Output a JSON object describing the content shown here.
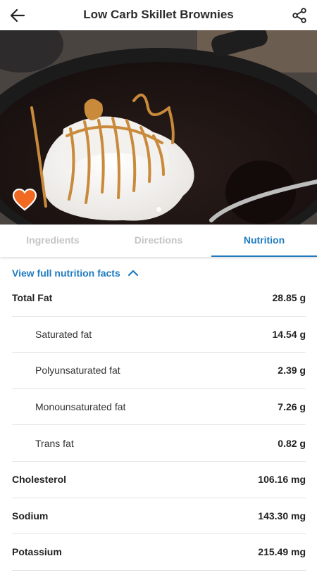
{
  "appbar": {
    "title": "Low Carb Skillet Brownies",
    "back_icon": "arrow-left-icon",
    "share_icon": "share-icon"
  },
  "hero": {
    "favorite_icon": "heart-icon",
    "favorite_color": "#f26a21",
    "page_count": 1,
    "current_page": 1
  },
  "tabs": [
    {
      "label": "Ingredients",
      "active": false
    },
    {
      "label": "Directions",
      "active": false
    },
    {
      "label": "Nutrition",
      "active": true
    }
  ],
  "accent_color": "#1f7bbf",
  "nutrition": {
    "toggle_label": "View full nutrition facts",
    "toggle_icon": "chevron-up-icon",
    "rows": [
      {
        "label": "Total Fat",
        "value": "28.85 g",
        "sub": false
      },
      {
        "label": "Saturated fat",
        "value": "14.54 g",
        "sub": true
      },
      {
        "label": "Polyunsaturated fat",
        "value": "2.39 g",
        "sub": true
      },
      {
        "label": "Monounsaturated fat",
        "value": "7.26 g",
        "sub": true
      },
      {
        "label": "Trans fat",
        "value": "0.82 g",
        "sub": true
      },
      {
        "label": "Cholesterol",
        "value": "106.16 mg",
        "sub": false
      },
      {
        "label": "Sodium",
        "value": "143.30 mg",
        "sub": false
      },
      {
        "label": "Potassium",
        "value": "215.49 mg",
        "sub": false
      }
    ]
  }
}
